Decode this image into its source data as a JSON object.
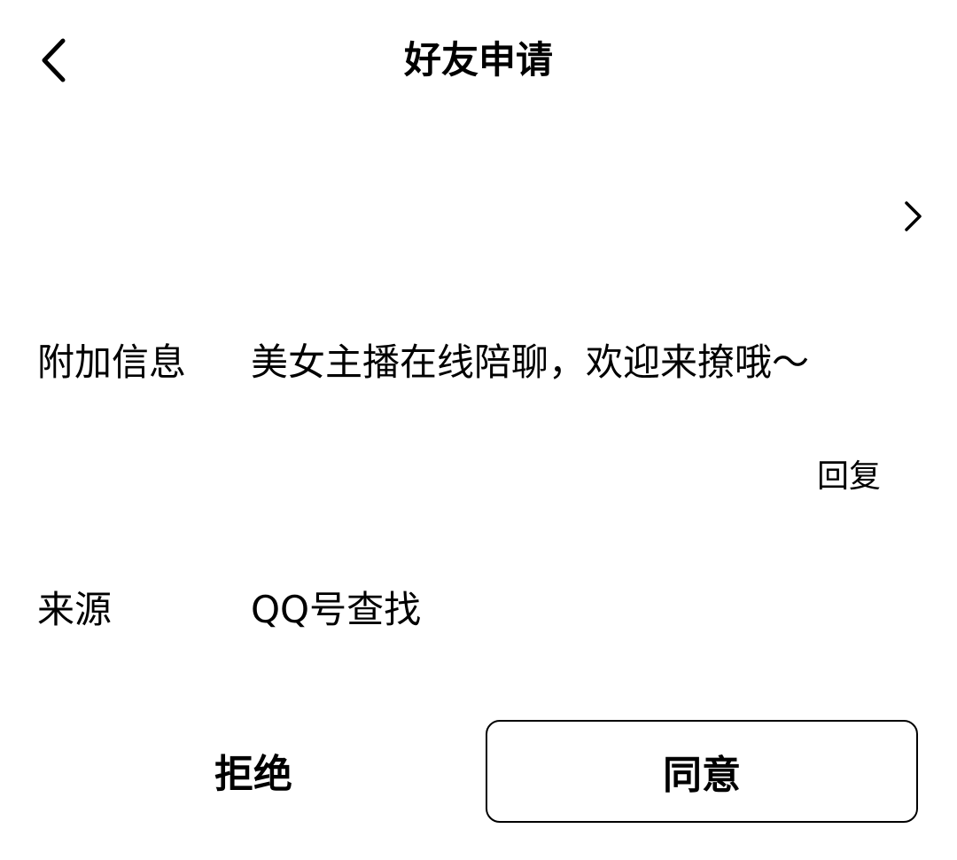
{
  "header": {
    "title": "好友申请",
    "back_icon": "chevron-left-icon"
  },
  "profile_row": {
    "chevron_icon": "chevron-right-icon"
  },
  "extra_info": {
    "label": "附加信息",
    "value": "美女主播在线陪聊，欢迎来撩哦～"
  },
  "reply": {
    "label": "回复"
  },
  "source": {
    "label": "来源",
    "value": "QQ号查找"
  },
  "actions": {
    "reject_label": "拒绝",
    "accept_label": "同意"
  },
  "colors": {
    "text": "#000000",
    "background": "#ffffff",
    "button_border": "#000000"
  }
}
